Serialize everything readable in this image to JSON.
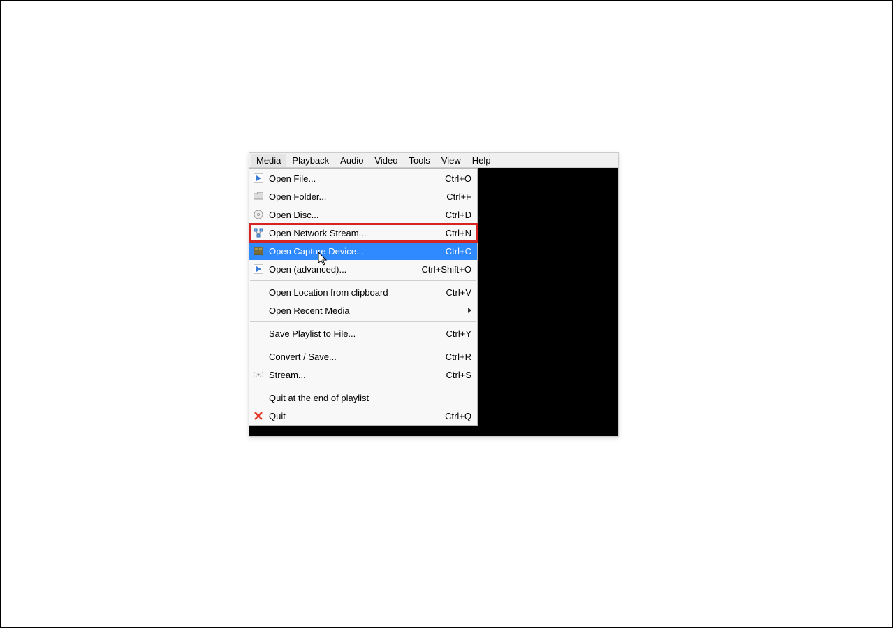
{
  "menubar": {
    "items": [
      "Media",
      "Playback",
      "Audio",
      "Video",
      "Tools",
      "View",
      "Help"
    ]
  },
  "menu": {
    "items": [
      {
        "icon": "play-file-icon",
        "label": "Open File...",
        "shortcut": "Ctrl+O"
      },
      {
        "icon": "folder-icon",
        "label": "Open Folder...",
        "shortcut": "Ctrl+F"
      },
      {
        "icon": "disc-icon",
        "label": "Open Disc...",
        "shortcut": "Ctrl+D"
      },
      {
        "icon": "network-icon",
        "label": "Open Network Stream...",
        "shortcut": "Ctrl+N",
        "red_highlight": true
      },
      {
        "icon": "capture-icon",
        "label": "Open Capture Device...",
        "shortcut": "Ctrl+C",
        "blue_highlight": true
      },
      {
        "icon": "play-file-icon",
        "label": "Open (advanced)...",
        "shortcut": "Ctrl+Shift+O"
      },
      {
        "separator": true
      },
      {
        "icon": "",
        "label": "Open Location from clipboard",
        "shortcut": "Ctrl+V"
      },
      {
        "icon": "",
        "label": "Open Recent Media",
        "shortcut": "",
        "submenu": true
      },
      {
        "separator": true
      },
      {
        "icon": "",
        "label": "Save Playlist to File...",
        "shortcut": "Ctrl+Y"
      },
      {
        "separator": true
      },
      {
        "icon": "",
        "label": "Convert / Save...",
        "shortcut": "Ctrl+R"
      },
      {
        "icon": "stream-icon",
        "label": "Stream...",
        "shortcut": "Ctrl+S"
      },
      {
        "separator": true
      },
      {
        "icon": "",
        "label": "Quit at the end of playlist",
        "shortcut": ""
      },
      {
        "icon": "close-icon",
        "label": "Quit",
        "shortcut": "Ctrl+Q"
      }
    ]
  }
}
